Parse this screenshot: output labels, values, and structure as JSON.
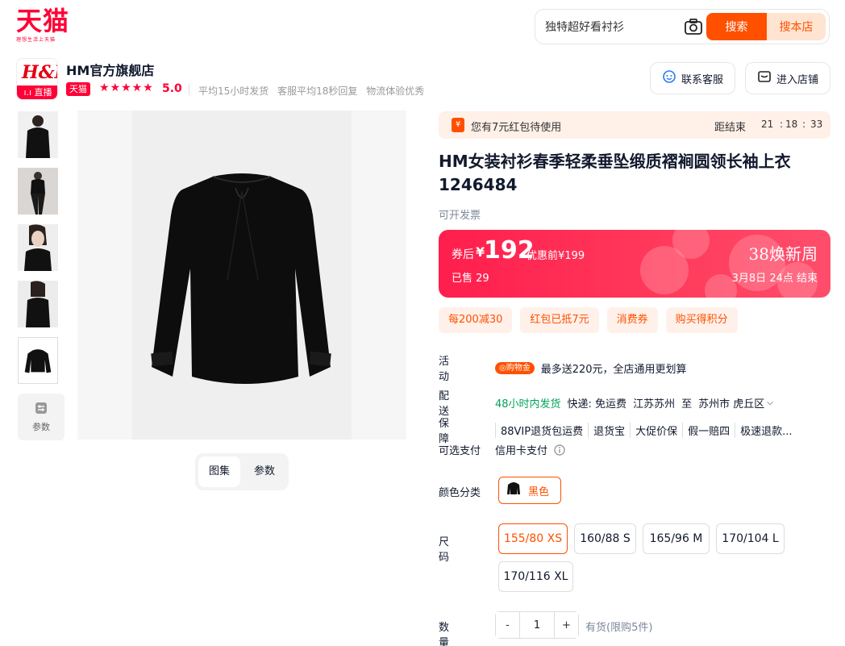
{
  "header": {
    "logo_text": "天猫",
    "logo_sub": "理想生活上天猫",
    "search_value": "独特超好看衬衫",
    "search_button": "搜索",
    "search_store_button": "搜本店"
  },
  "shop": {
    "logo_text": "H&M",
    "live_badge": "直播",
    "name": "HM官方旗舰店",
    "tmall_badge": "天猫",
    "rating_stars": 5,
    "rating_score": "5.0",
    "stats": [
      "平均15小时发货",
      "客服平均18秒回复",
      "物流体验优秀"
    ],
    "contact_button": "联系客服",
    "enter_store_button": "进入店铺"
  },
  "gallery": {
    "param_button": "参数",
    "tabs": [
      "图集",
      "参数"
    ]
  },
  "coupon_bar": {
    "text": "您有7元红包待使用",
    "countdown_label": "距结束",
    "hours": "21",
    "minutes": "18",
    "seconds": "33",
    "sep": ":"
  },
  "product": {
    "title": "HM女装衬衫春季轻柔垂坠缎质褶裥圆领长袖上衣1246484",
    "invoice": "可开发票"
  },
  "price": {
    "prefix": "券后",
    "currency": "¥",
    "amount": "192",
    "original": "优惠前¥199",
    "sold": "已售 29",
    "event_name": "38焕新周",
    "event_date": "3月8日 24点 结束"
  },
  "promos": [
    "每200减30",
    "红包已抵7元",
    "消费券",
    "购买得积分"
  ],
  "activity": {
    "label": "活动",
    "tag": "购物金",
    "text": "最多送220元，全店通用更划算"
  },
  "delivery": {
    "label": "配送",
    "speed": "48小时内发货",
    "express": "快递: 免运费",
    "from": "江苏苏州",
    "to_word": "至",
    "to": "苏州市 虎丘区"
  },
  "guarantee": {
    "label": "保障",
    "items": [
      "88VIP退货包运费",
      "退货宝",
      "大促价保",
      "假一赔四",
      "极速退款..."
    ]
  },
  "payment": {
    "label": "可选支付",
    "value": "信用卡支付"
  },
  "color": {
    "label": "颜色分类",
    "option": "黑色"
  },
  "size": {
    "label": "尺码",
    "options": [
      "155/80 XS",
      "160/88 S",
      "165/96 M",
      "170/104 L",
      "170/116 XL"
    ],
    "selected": "155/80 XS"
  },
  "quantity": {
    "label": "数量",
    "minus": "-",
    "value": "1",
    "plus": "+",
    "stock": "有货(限购5件)"
  },
  "colors": {
    "brand": "#ff0036",
    "accent": "#ff5000",
    "green": "#00a45a"
  }
}
